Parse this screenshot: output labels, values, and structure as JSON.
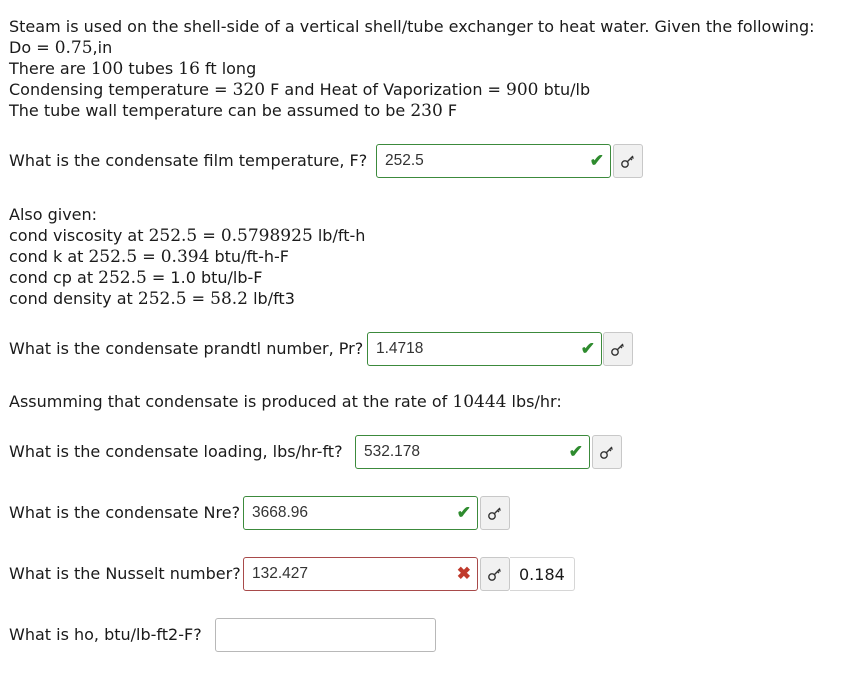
{
  "intro": {
    "l1": "Steam is used on the shell-side of a vertical shell/tube exchanger to heat water. Given the following:",
    "l2_pre": "Do = ",
    "l2_val": "0.75",
    "l2_post": ",in",
    "l3_pre": "There are ",
    "l3_val1": "100",
    "l3_mid": " tubes ",
    "l3_val2": "16",
    "l3_post": " ft long",
    "l4_pre": "Condensing temperature = ",
    "l4_val1": "320",
    "l4_mid": " F and Heat of Vaporization = ",
    "l4_val2": "900",
    "l4_post": " btu/lb",
    "l5_pre": "The tube wall temperature can be assumed to be ",
    "l5_val": "230",
    "l5_post": " F"
  },
  "also": {
    "title": "Also given:",
    "visc_pre": "cond viscosity at ",
    "visc_t": "252.5",
    "visc_eq": " = ",
    "visc_v": "0.5798925",
    "visc_u": " lb/ft-h",
    "k_pre": "cond k at ",
    "k_t": "252.5",
    "k_eq": " = ",
    "k_v": "0.394",
    "k_u": " btu/ft-h-F",
    "cp_pre": "cond cp at ",
    "cp_t": "252.5",
    "cp_rest": " = 1.0 btu/lb-F",
    "rho_pre": "cond density at ",
    "rho_t": "252.5",
    "rho_eq": " = ",
    "rho_v": "58.2",
    "rho_u": " lb/ft3"
  },
  "rate": {
    "pre": "Assumming that condensate is produced at the rate of ",
    "val": "10444",
    "post": " lbs/hr:"
  },
  "questions": [
    {
      "label": "What is the condensate film temperature, F?",
      "value": "252.5",
      "status": "correct"
    },
    {
      "label": "What is the condensate prandtl number, Pr?",
      "value": "1.4718",
      "status": "correct"
    },
    {
      "label": "What is the condensate loading, lbs/hr-ft?",
      "value": "532.178",
      "status": "correct"
    },
    {
      "label": "What is the condensate Nre?",
      "value": "3668.96",
      "status": "correct"
    },
    {
      "label": "What is the Nusselt number?",
      "value": "132.427",
      "status": "incorrect",
      "score": "0.184"
    },
    {
      "label": "What is ho, btu/lb-ft2-F?",
      "value": "",
      "status": "empty"
    }
  ],
  "icons": {
    "check": "check-icon",
    "cross": "cross-icon",
    "key": "key-icon"
  },
  "colors": {
    "correct": "#2e8b2e",
    "incorrect": "#c0392b"
  }
}
